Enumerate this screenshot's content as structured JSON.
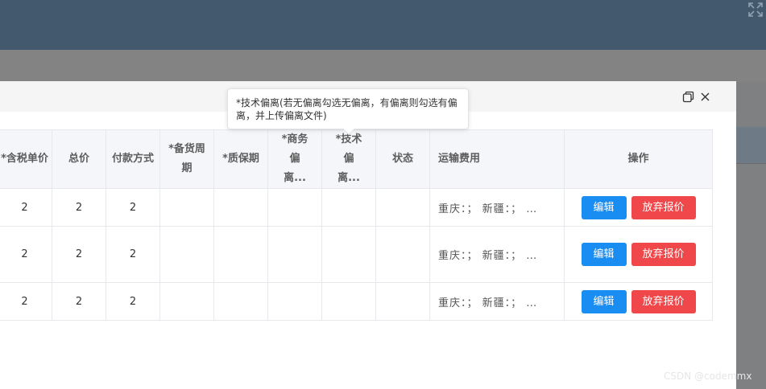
{
  "dialog": {
    "columns": [
      "*含税单价",
      "总价",
      "付款方式",
      "*备货周期",
      "*质保期",
      "*商务偏离...",
      "*技术偏离...",
      "状态",
      "运输费用",
      "操作"
    ],
    "rows": [
      {
        "unit_price": "2",
        "total": "2",
        "payment": "2",
        "stock_period": "",
        "warranty": "",
        "business_dev": "",
        "tech_dev": "",
        "status": "",
        "freight": "重庆：；  新疆：；  …"
      },
      {
        "unit_price": "2",
        "total": "2",
        "payment": "2",
        "stock_period": "",
        "warranty": "",
        "business_dev": "",
        "tech_dev": "",
        "status": "",
        "freight": "重庆：；  新疆：；  …"
      },
      {
        "unit_price": "2",
        "total": "2",
        "payment": "2",
        "stock_period": "",
        "warranty": "",
        "business_dev": "",
        "tech_dev": "",
        "status": "",
        "freight": "重庆：；  新疆：；  …"
      }
    ],
    "actions": {
      "edit_label": "编辑",
      "abandon_label": "放弃报价"
    },
    "icons": {
      "maximize": "maximize-icon",
      "close": "close-icon"
    }
  },
  "tooltip": {
    "text": "*技术偏离(若无偏离勾选无偏离，有偏离则勾选有偏离，并上传偏离文件)"
  },
  "watermark": {
    "text": "CSDN @codemmx"
  },
  "colors": {
    "primary": "#1a8df2",
    "danger": "#f0474a",
    "header_bg": "#43596d"
  }
}
